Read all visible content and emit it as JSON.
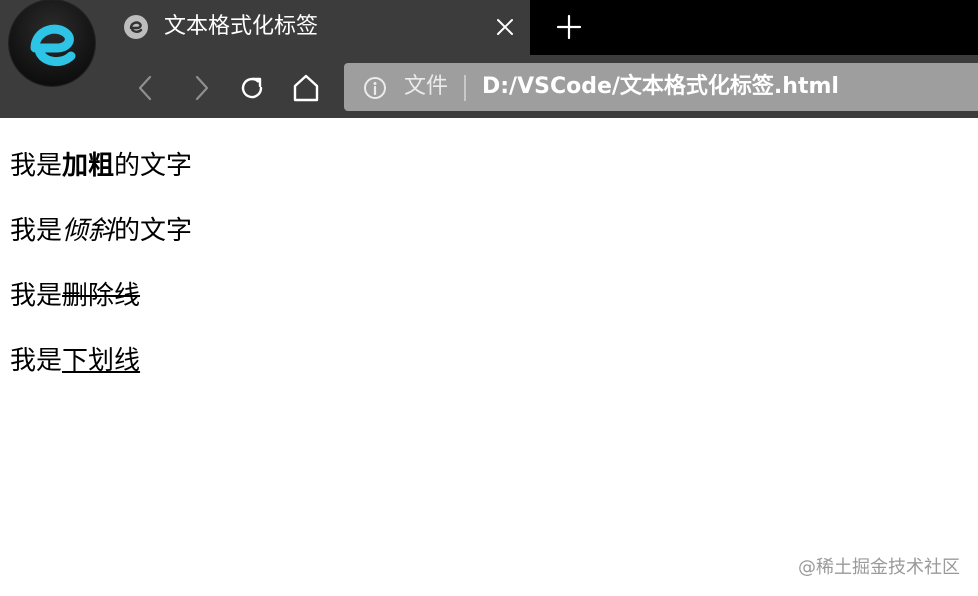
{
  "browser": {
    "tab": {
      "title": "文本格式化标签",
      "close_icon": "close-icon",
      "favicon": "browser-logo-icon"
    },
    "new_tab_icon": "plus-icon",
    "nav": {
      "back_icon": "chevron-left-icon",
      "forward_icon": "chevron-right-icon",
      "reload_icon": "reload-icon",
      "home_icon": "home-icon"
    },
    "address": {
      "info_icon": "info-icon",
      "scheme_label": "文件",
      "url": "D:/VSCode/文本格式化标签.html"
    },
    "colors": {
      "chrome": "#3c3c3c",
      "titlebar": "#000000",
      "address_bar": "#9e9e9e",
      "accent": "#2ec4e6"
    }
  },
  "page": {
    "lines": [
      {
        "prefix": "我是",
        "styled": "加粗",
        "suffix": "的文字"
      },
      {
        "prefix": "我是",
        "styled": "倾斜",
        "suffix": "的文字"
      },
      {
        "prefix": "我是",
        "styled": "删除线",
        "suffix": ""
      },
      {
        "prefix": "我是",
        "styled": "下划线",
        "suffix": ""
      }
    ]
  },
  "watermark": "@稀土掘金技术社区"
}
